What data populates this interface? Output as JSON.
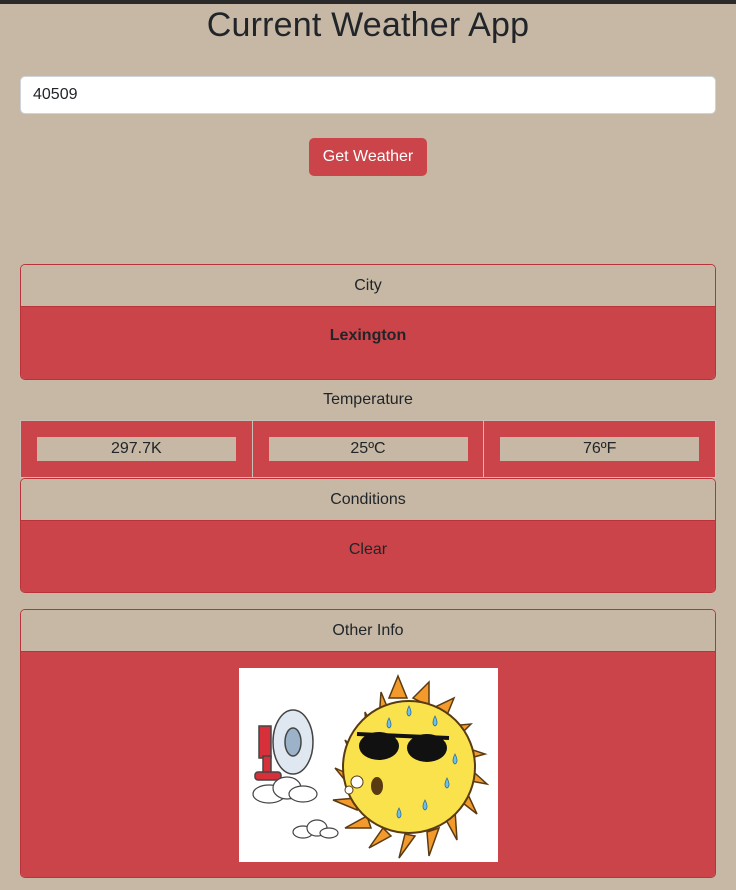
{
  "app": {
    "title": "Current Weather App"
  },
  "search": {
    "zip_value": "40509",
    "button_label": "Get Weather"
  },
  "city": {
    "header": "City",
    "value": "Lexington"
  },
  "temperature": {
    "label": "Temperature",
    "kelvin": "297.7K",
    "celsius": "25ºC",
    "fahrenheit": "76ºF"
  },
  "conditions": {
    "header": "Conditions",
    "value": "Clear"
  },
  "other": {
    "header": "Other Info",
    "image_icon": "hot-sun-with-fan-illustration"
  },
  "colors": {
    "background": "#c6b8a4",
    "accent": "#cb4449",
    "text": "#212529"
  }
}
